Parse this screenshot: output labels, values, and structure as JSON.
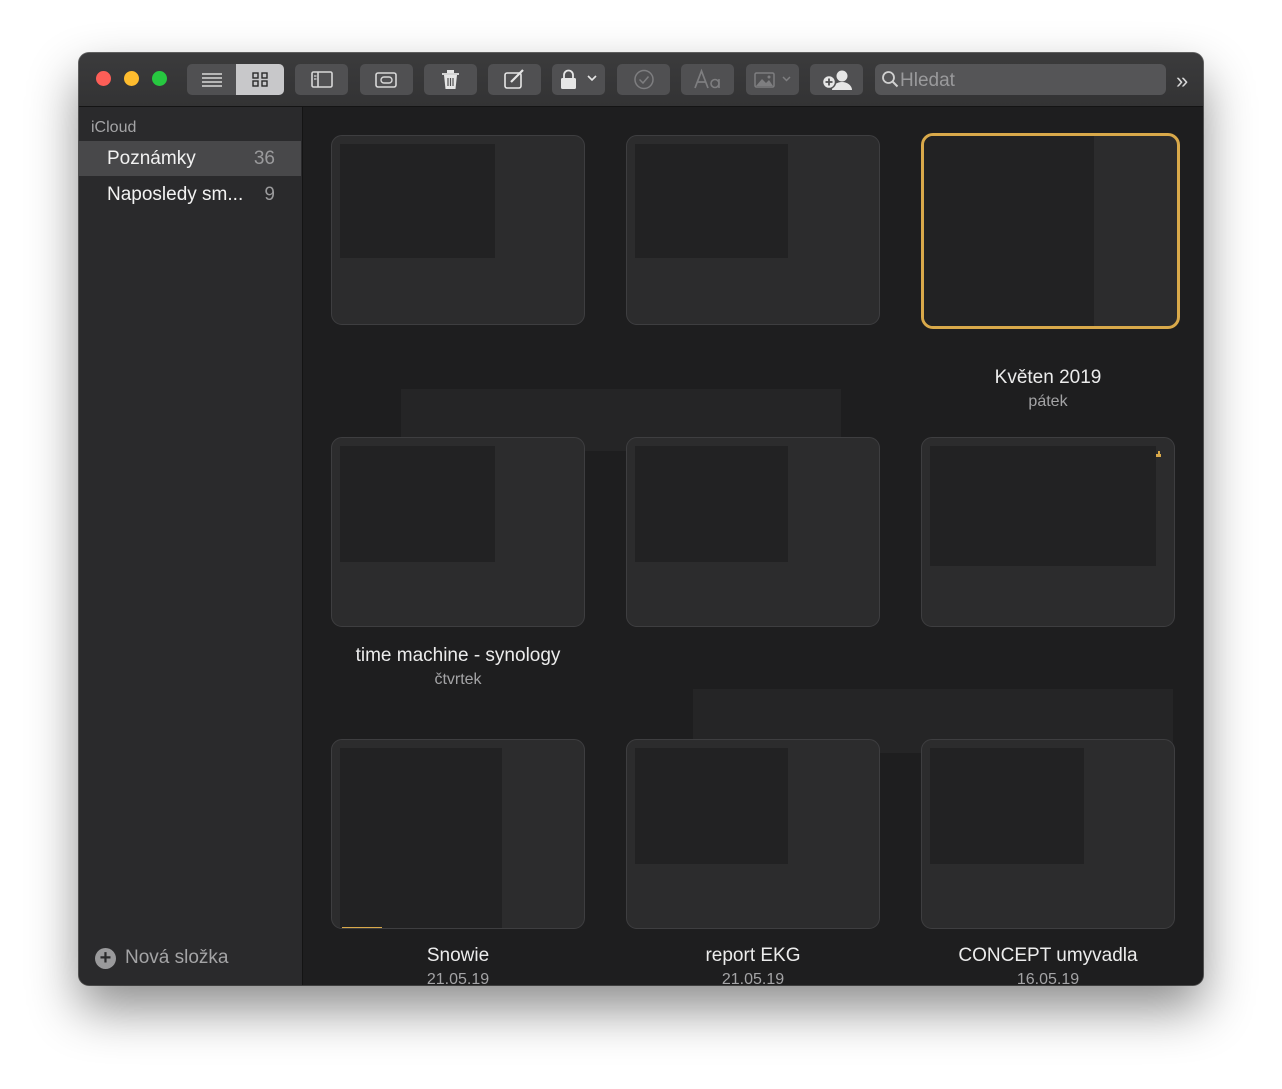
{
  "toolbar": {
    "search_placeholder": "Hledat",
    "icons": [
      "list-view-icon",
      "gallery-view-icon",
      "sidebar-toggle-icon",
      "attachments-icon",
      "trash-icon",
      "compose-icon",
      "lock-icon",
      "checklist-icon",
      "format-icon",
      "media-icon",
      "share-icon",
      "search-icon",
      "overflow-icon"
    ],
    "accent_color": "#d9a94a"
  },
  "sidebar": {
    "section_label": "iCloud",
    "folders": [
      {
        "name": "Poznámky",
        "count": "36"
      },
      {
        "name": "Naposledy sm...",
        "count": "9"
      }
    ],
    "new_folder_label": "Nová složka"
  },
  "notes": [
    {
      "title": "",
      "date": ""
    },
    {
      "title": "",
      "date": ""
    },
    {
      "title": "Květen 2019",
      "date": "pátek"
    },
    {
      "title": "time machine - synology",
      "date": "čtvrtek"
    },
    {
      "title": "",
      "date": ""
    },
    {
      "title": "",
      "date": ""
    },
    {
      "title": "Snowie",
      "date": "21.05.19"
    },
    {
      "title": "report EKG",
      "date": "21.05.19"
    },
    {
      "title": "CONCEPT umyvadla",
      "date": "16.05.19"
    }
  ]
}
